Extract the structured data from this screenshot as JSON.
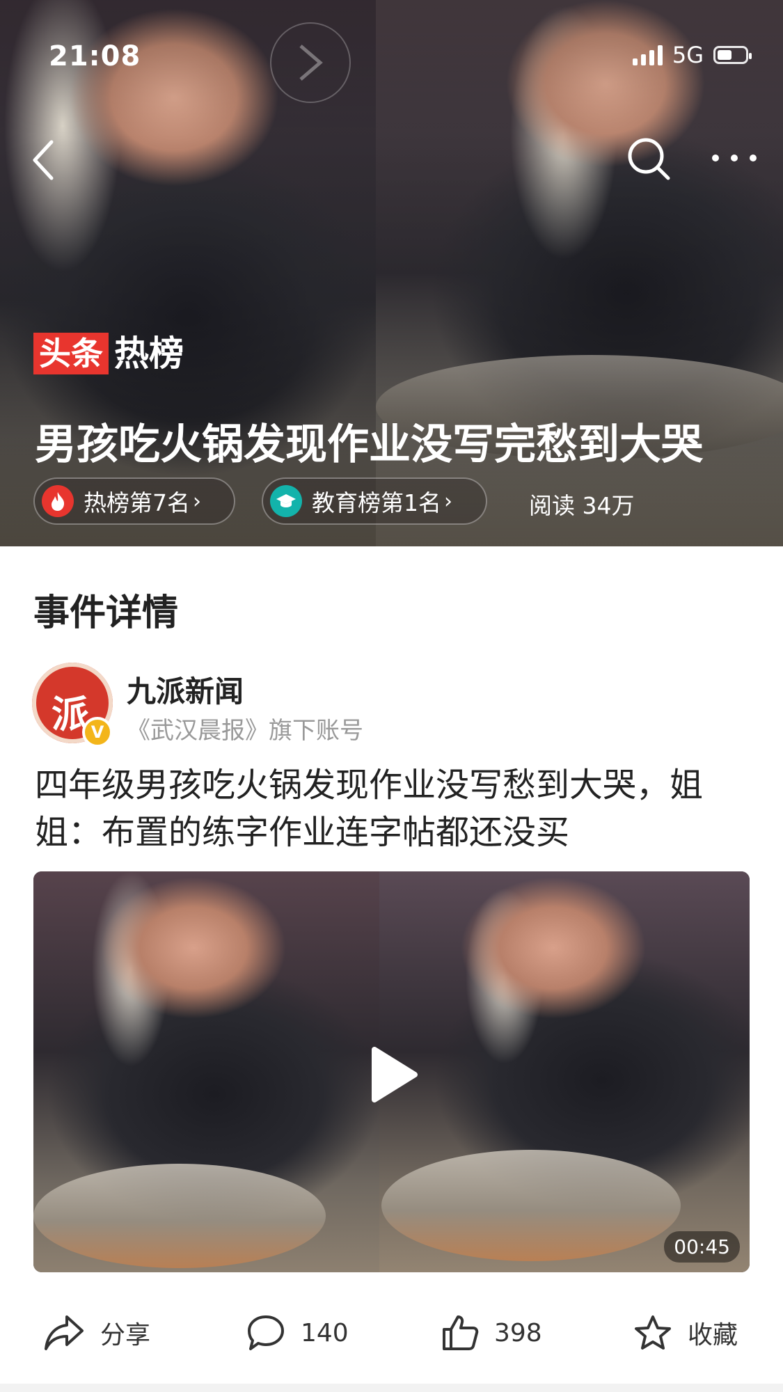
{
  "status_bar": {
    "time": "21:08",
    "network": "5G"
  },
  "hero": {
    "logo_red": "头条",
    "logo_white": "热榜",
    "title": "男孩吃火锅发现作业没写完愁到大哭",
    "chips": [
      {
        "label": "热榜第7名",
        "icon": "flame-icon",
        "color": "#e8352e"
      },
      {
        "label": "教育榜第1名",
        "icon": "graduation-cap-icon",
        "color": "#13b3ab"
      }
    ],
    "read_count": "阅读 34万"
  },
  "section": {
    "title": "事件详情"
  },
  "author": {
    "name": "九派新闻",
    "description": "《武汉晨报》旗下账号",
    "avatar_mark": "派",
    "badge": "V"
  },
  "article": {
    "title": "四年级男孩吃火锅发现作业没写愁到大哭，姐姐：布置的练字作业连字帖都还没买"
  },
  "video": {
    "duration": "00:45"
  },
  "actions": {
    "share": "分享",
    "comments": "140",
    "likes": "398",
    "favorite": "收藏"
  }
}
